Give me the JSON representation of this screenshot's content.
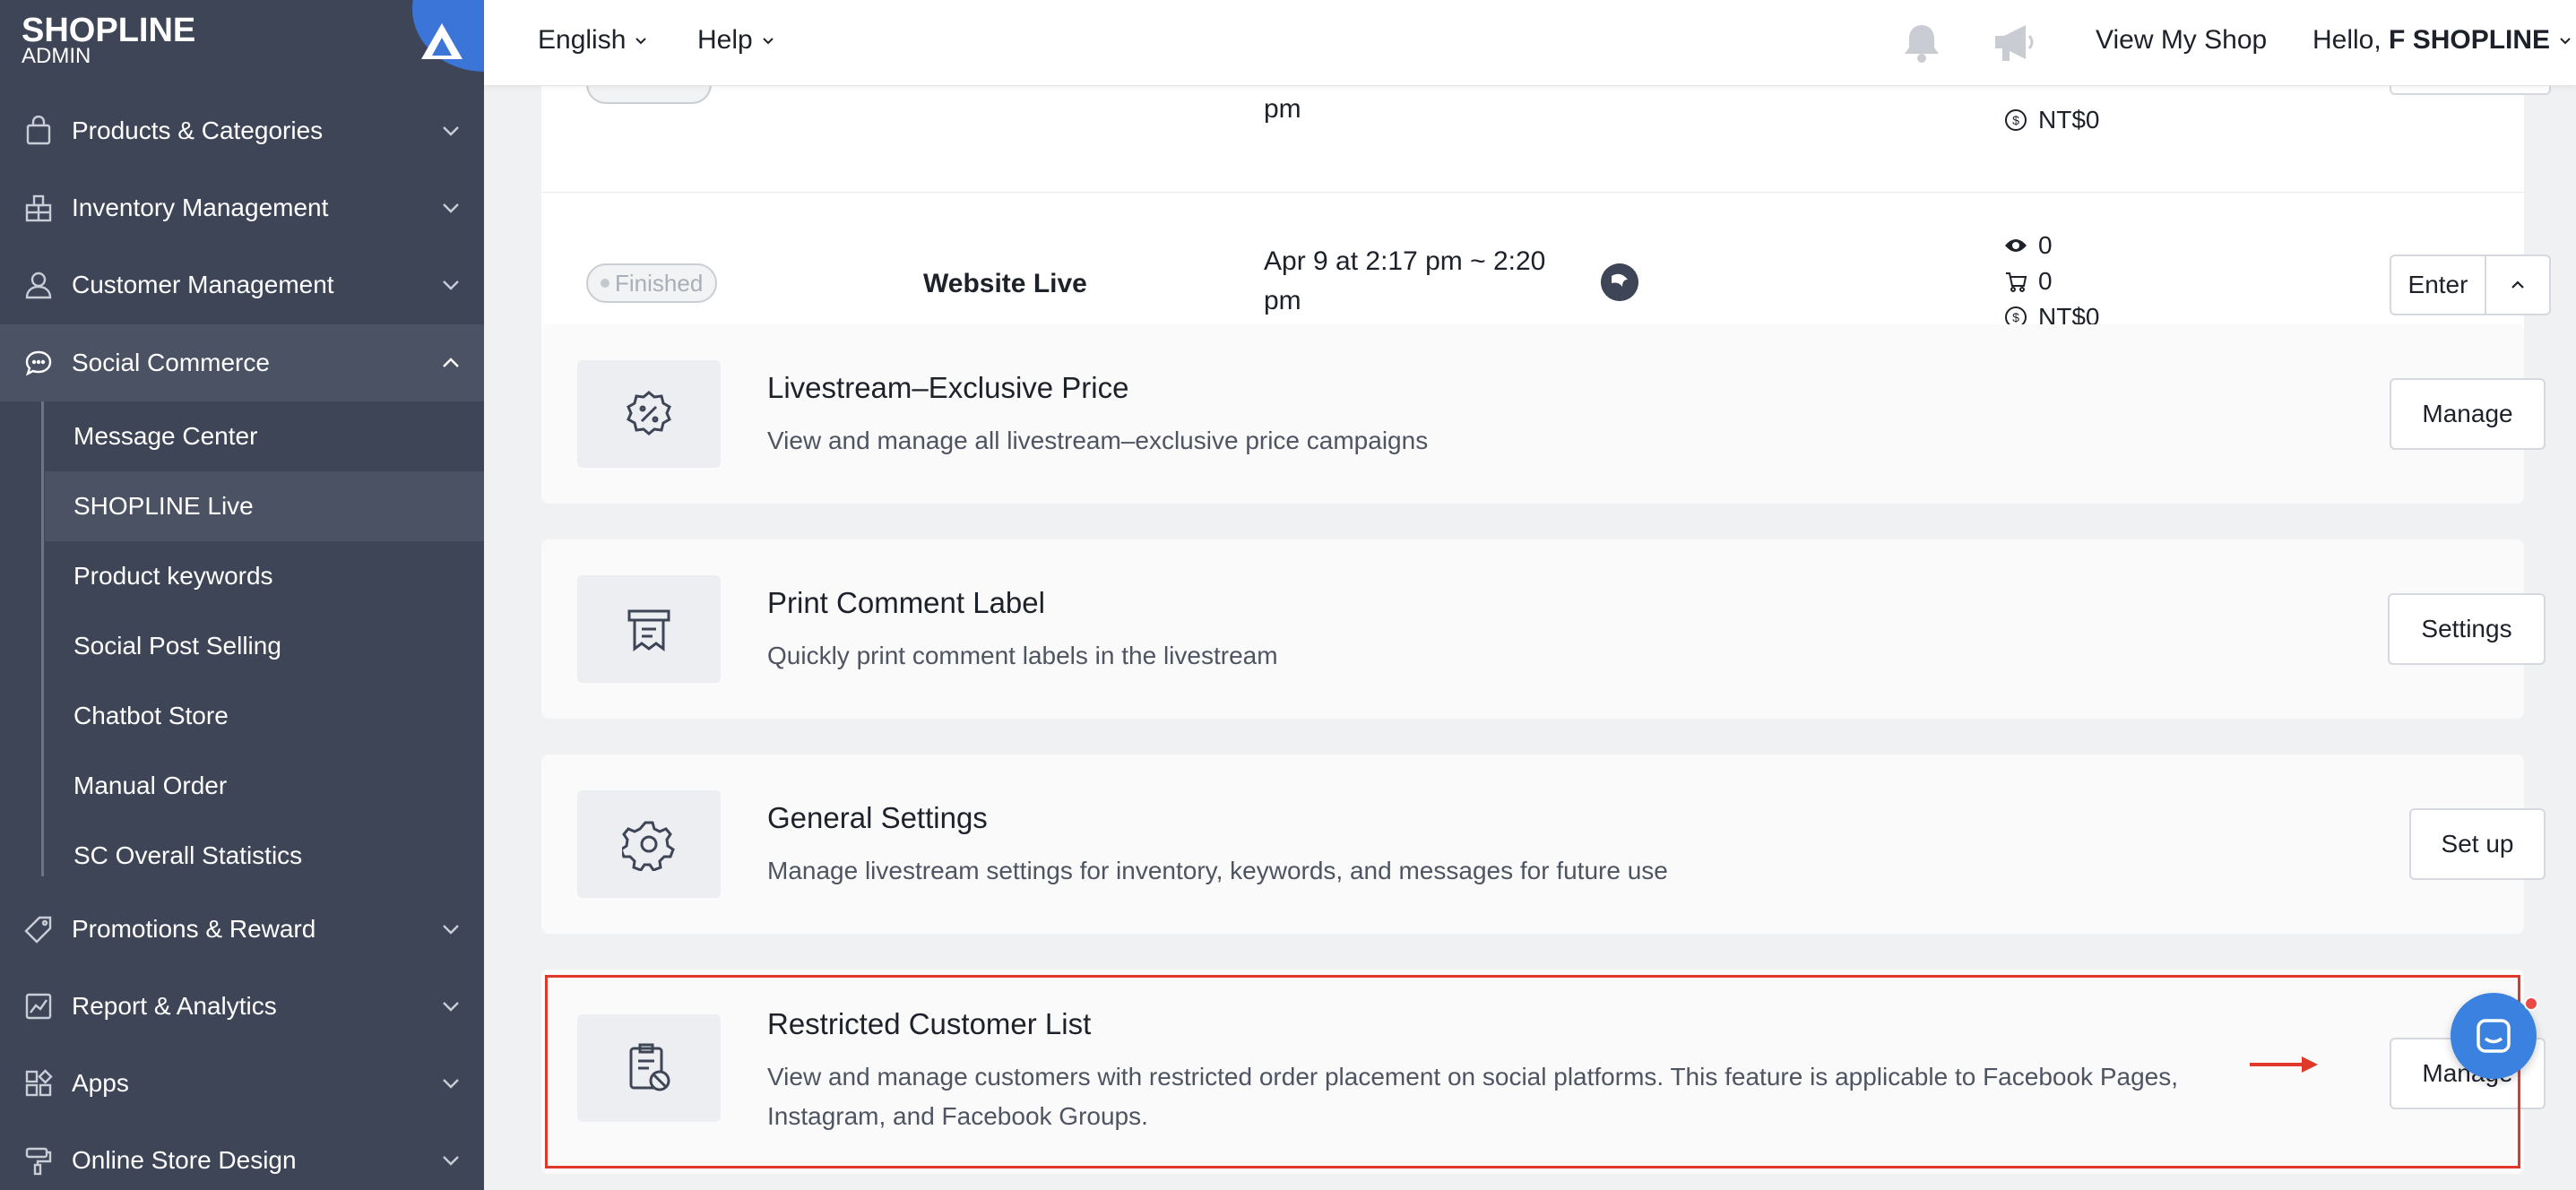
{
  "sidebar": {
    "logo": "SHOPLINE",
    "logo_sub": "ADMIN",
    "items": [
      {
        "label": "Products & Categories",
        "icon": "bag-icon"
      },
      {
        "label": "Inventory Management",
        "icon": "warehouse-icon"
      },
      {
        "label": "Customer Management",
        "icon": "person-icon"
      },
      {
        "label": "Social Commerce",
        "icon": "chat-bubble-icon"
      },
      {
        "label": "Promotions & Reward",
        "icon": "tag-icon"
      },
      {
        "label": "Report & Analytics",
        "icon": "chart-icon"
      },
      {
        "label": "Apps",
        "icon": "apps-grid-icon"
      },
      {
        "label": "Online Store Design",
        "icon": "paint-roller-icon"
      }
    ],
    "sub_items": [
      {
        "label": "Message Center"
      },
      {
        "label": "SHOPLINE Live"
      },
      {
        "label": "Product keywords"
      },
      {
        "label": "Social Post Selling"
      },
      {
        "label": "Chatbot Store"
      },
      {
        "label": "Manual Order"
      },
      {
        "label": "SC Overall Statistics"
      }
    ]
  },
  "topbar": {
    "language": "English",
    "help": "Help",
    "view_shop": "View My Shop",
    "greeting": "Hello,",
    "user": "F SHOPLINE"
  },
  "live_rows": [
    {
      "time_tail": "pm",
      "revenue": "NT$0"
    },
    {
      "status": "Finished",
      "channel": "Website Live",
      "time": "Apr 9 at 2:17 pm ~ 2:20 pm",
      "views": "0",
      "orders": "0",
      "revenue": "NT$0",
      "enter": "Enter"
    }
  ],
  "features": [
    {
      "title": "Livestream–Exclusive Price",
      "desc": "View and manage all livestream–exclusive price campaigns",
      "button": "Manage",
      "icon": "discount-badge-icon"
    },
    {
      "title": "Print Comment Label",
      "desc": "Quickly print comment labels in the livestream",
      "button": "Settings",
      "icon": "printer-icon"
    },
    {
      "title": "General Settings",
      "desc": "Manage livestream settings for inventory, keywords, and messages for future use",
      "button": "Set up",
      "icon": "gear-icon"
    },
    {
      "title": "Restricted Customer List",
      "desc": "View and manage customers with restricted order placement on social platforms. This feature is applicable to Facebook Pages, Instagram, and Facebook Groups.",
      "button": "Manage",
      "icon": "clipboard-block-icon"
    }
  ],
  "colors": {
    "sidebar": "#3e4557",
    "accent": "#3b82e0",
    "highlight": "#e0392a"
  }
}
